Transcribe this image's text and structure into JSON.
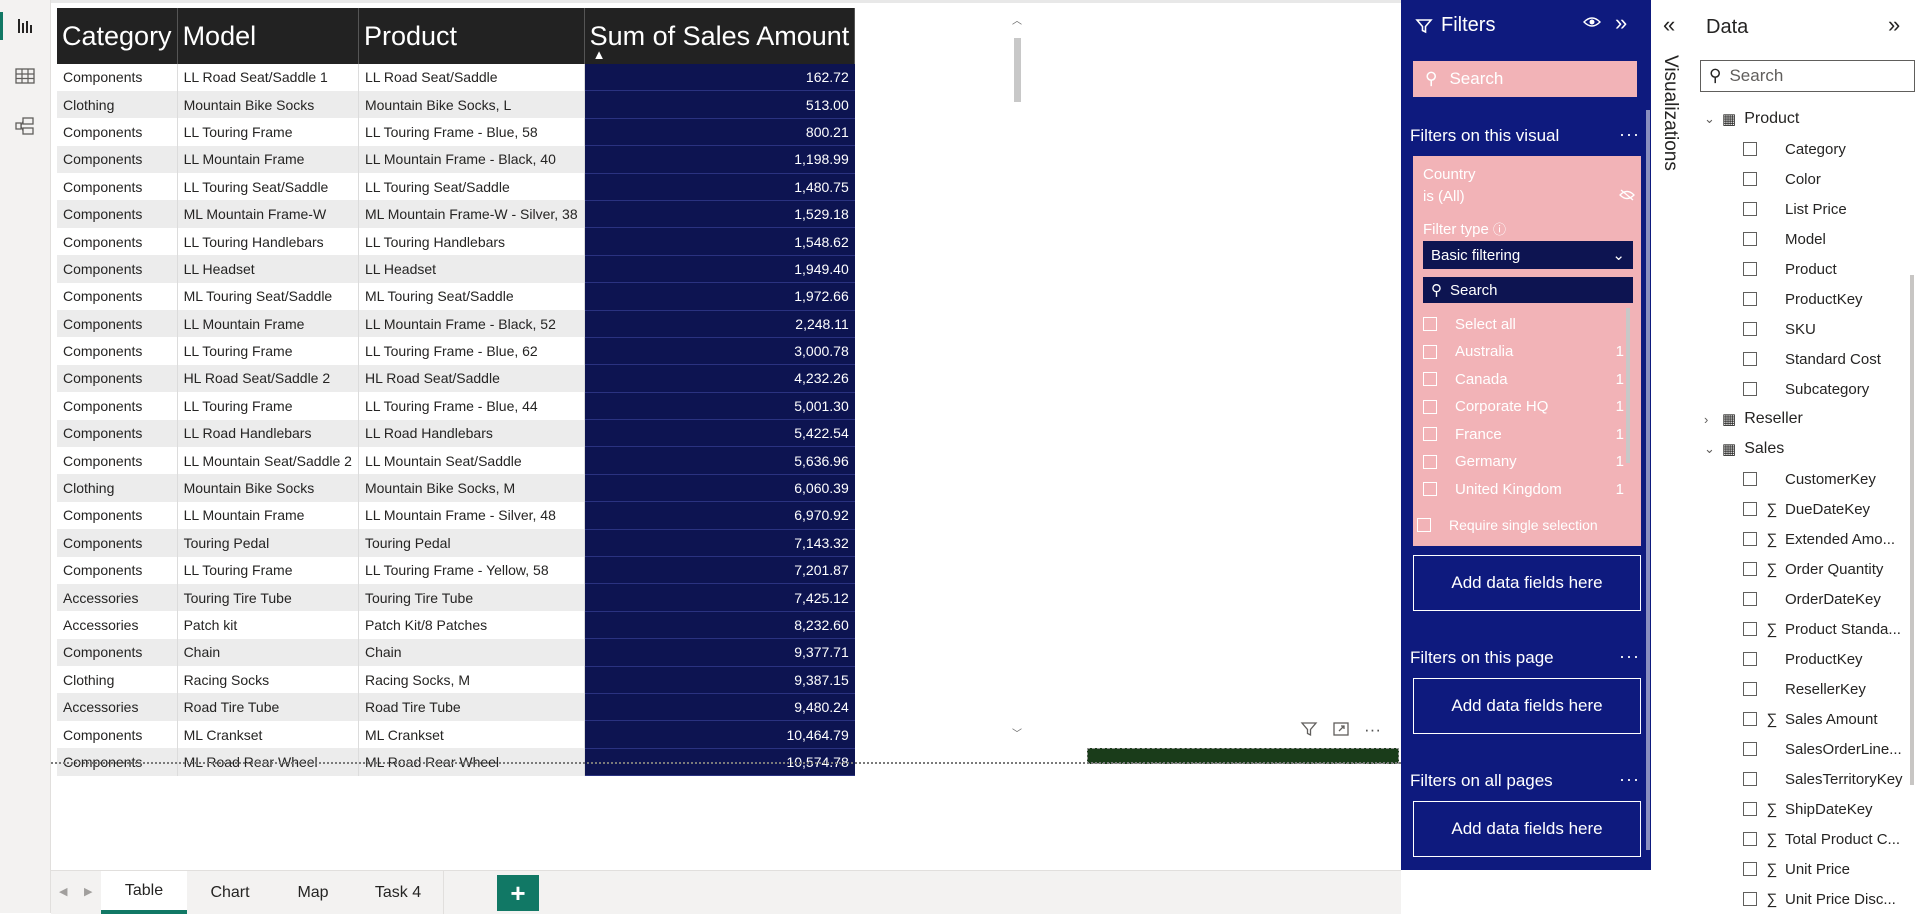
{
  "left_rail": {
    "items": [
      {
        "name": "report-view",
        "icon": "bar-chart-icon"
      },
      {
        "name": "table-view",
        "icon": "grid-icon"
      },
      {
        "name": "model-view",
        "icon": "model-icon"
      }
    ]
  },
  "table_visual": {
    "columns": [
      "Category",
      "Model",
      "Product",
      "Sum of Sales Amount"
    ],
    "sort_indicator": "▲",
    "rows": [
      [
        "Components",
        "LL Road Seat/Saddle 1",
        "LL Road Seat/Saddle",
        "162.72"
      ],
      [
        "Clothing",
        "Mountain Bike Socks",
        "Mountain Bike Socks, L",
        "513.00"
      ],
      [
        "Components",
        "LL Touring Frame",
        "LL Touring Frame - Blue, 58",
        "800.21"
      ],
      [
        "Components",
        "LL Mountain Frame",
        "LL Mountain Frame - Black, 40",
        "1,198.99"
      ],
      [
        "Components",
        "LL Touring Seat/Saddle",
        "LL Touring Seat/Saddle",
        "1,480.75"
      ],
      [
        "Components",
        "ML Mountain Frame-W",
        "ML Mountain Frame-W - Silver, 38",
        "1,529.18"
      ],
      [
        "Components",
        "LL Touring Handlebars",
        "LL Touring Handlebars",
        "1,548.62"
      ],
      [
        "Components",
        "LL Headset",
        "LL Headset",
        "1,949.40"
      ],
      [
        "Components",
        "ML Touring Seat/Saddle",
        "ML Touring Seat/Saddle",
        "1,972.66"
      ],
      [
        "Components",
        "LL Mountain Frame",
        "LL Mountain Frame - Black, 52",
        "2,248.11"
      ],
      [
        "Components",
        "LL Touring Frame",
        "LL Touring Frame - Blue, 62",
        "3,000.78"
      ],
      [
        "Components",
        "HL Road Seat/Saddle 2",
        "HL Road Seat/Saddle",
        "4,232.26"
      ],
      [
        "Components",
        "LL Touring Frame",
        "LL Touring Frame - Blue, 44",
        "5,001.30"
      ],
      [
        "Components",
        "LL Road Handlebars",
        "LL Road Handlebars",
        "5,422.54"
      ],
      [
        "Components",
        "LL Mountain Seat/Saddle 2",
        "LL Mountain Seat/Saddle",
        "5,636.96"
      ],
      [
        "Clothing",
        "Mountain Bike Socks",
        "Mountain Bike Socks, M",
        "6,060.39"
      ],
      [
        "Components",
        "LL Mountain Frame",
        "LL Mountain Frame - Silver, 48",
        "6,970.92"
      ],
      [
        "Components",
        "Touring Pedal",
        "Touring Pedal",
        "7,143.32"
      ],
      [
        "Components",
        "LL Touring Frame",
        "LL Touring Frame - Yellow, 58",
        "7,201.87"
      ],
      [
        "Accessories",
        "Touring Tire Tube",
        "Touring Tire Tube",
        "7,425.12"
      ],
      [
        "Accessories",
        "Patch kit",
        "Patch Kit/8 Patches",
        "8,232.60"
      ],
      [
        "Components",
        "Chain",
        "Chain",
        "9,377.71"
      ],
      [
        "Clothing",
        "Racing Socks",
        "Racing Socks, M",
        "9,387.15"
      ],
      [
        "Accessories",
        "Road Tire Tube",
        "Road Tire Tube",
        "9,480.24"
      ],
      [
        "Components",
        "ML Crankset",
        "ML Crankset",
        "10,464.79"
      ],
      [
        "Components",
        "ML Road Rear Wheel",
        "ML Road Rear Wheel",
        "10,574.78"
      ]
    ]
  },
  "visual_header": {
    "icons": [
      "filter-icon",
      "focus-mode-icon",
      "more-options-icon"
    ],
    "more": "···"
  },
  "page_tabs": {
    "tabs": [
      "Table",
      "Chart",
      "Map",
      "Task 4"
    ],
    "active": "Table",
    "add_label": "+"
  },
  "filters_pane": {
    "title": "Filters",
    "search_placeholder": "Search",
    "on_visual_title": "Filters on this visual",
    "more": "···",
    "country_card": {
      "field": "Country",
      "state": "is (All)",
      "filter_type_label": "Filter type",
      "filter_type_value": "Basic filtering",
      "search_placeholder": "Search",
      "items": [
        {
          "label": "Select all",
          "count": ""
        },
        {
          "label": "Australia",
          "count": "1"
        },
        {
          "label": "Canada",
          "count": "1"
        },
        {
          "label": "Corporate HQ",
          "count": "1"
        },
        {
          "label": "France",
          "count": "1"
        },
        {
          "label": "Germany",
          "count": "1"
        },
        {
          "label": "United Kingdom",
          "count": "1"
        }
      ],
      "require_single": "Require single selection"
    },
    "add_fields_label": "Add data fields here",
    "on_page_title": "Filters on this page",
    "on_all_pages_title": "Filters on all pages",
    "accent_color": "#0e1a7e",
    "card_color": "#f2b3b7"
  },
  "visualizations_pane": {
    "label": "Visualizations"
  },
  "data_pane": {
    "title": "Data",
    "search_placeholder": "Search",
    "tables": [
      {
        "name": "Product",
        "expanded": true,
        "fields": [
          {
            "name": "Category",
            "sigma": false
          },
          {
            "name": "Color",
            "sigma": false
          },
          {
            "name": "List Price",
            "sigma": false
          },
          {
            "name": "Model",
            "sigma": false
          },
          {
            "name": "Product",
            "sigma": false
          },
          {
            "name": "ProductKey",
            "sigma": false
          },
          {
            "name": "SKU",
            "sigma": false
          },
          {
            "name": "Standard Cost",
            "sigma": false
          },
          {
            "name": "Subcategory",
            "sigma": false
          }
        ]
      },
      {
        "name": "Reseller",
        "expanded": false,
        "fields": []
      },
      {
        "name": "Sales",
        "expanded": true,
        "fields": [
          {
            "name": "CustomerKey",
            "sigma": false
          },
          {
            "name": "DueDateKey",
            "sigma": true
          },
          {
            "name": "Extended Amo...",
            "sigma": true
          },
          {
            "name": "Order Quantity",
            "sigma": true
          },
          {
            "name": "OrderDateKey",
            "sigma": false
          },
          {
            "name": "Product Standa...",
            "sigma": true
          },
          {
            "name": "ProductKey",
            "sigma": false
          },
          {
            "name": "ResellerKey",
            "sigma": false
          },
          {
            "name": "Sales Amount",
            "sigma": true
          },
          {
            "name": "SalesOrderLine...",
            "sigma": false
          },
          {
            "name": "SalesTerritoryKey",
            "sigma": false
          },
          {
            "name": "ShipDateKey",
            "sigma": true
          },
          {
            "name": "Total Product C...",
            "sigma": true
          },
          {
            "name": "Unit Price",
            "sigma": true
          },
          {
            "name": "Unit Price Disc...",
            "sigma": true
          }
        ]
      }
    ]
  }
}
